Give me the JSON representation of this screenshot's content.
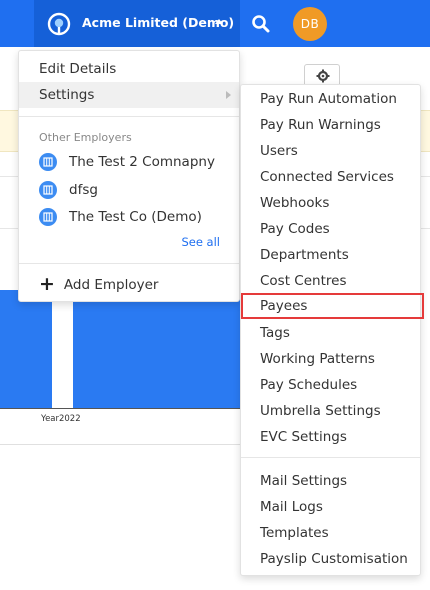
{
  "topbar": {
    "employer_name": "Acme Limited (Demo)",
    "avatar_initials": "DB"
  },
  "background": {
    "chart_x_label": "Year2022"
  },
  "employer_menu": {
    "edit_details": "Edit Details",
    "settings": "Settings",
    "other_employers_caption": "Other Employers",
    "other_employers": [
      "The Test 2 Comnapny",
      "dfsg",
      "The Test Co (Demo)"
    ],
    "see_all": "See all",
    "add_employer": "Add Employer"
  },
  "settings_menu": {
    "items": [
      "Pay Run Automation",
      "Pay Run Warnings",
      "Users",
      "Connected Services",
      "Webhooks",
      "Pay Codes",
      "Departments",
      "Cost Centres",
      "Payees",
      "Tags",
      "Working Patterns",
      "Pay Schedules",
      "Umbrella Settings",
      "EVC Settings"
    ],
    "secondary_items": [
      "Mail Settings",
      "Mail Logs",
      "Templates",
      "Payslip Customisation"
    ],
    "highlighted_item": "Payees"
  },
  "colors": {
    "topbar": "#1f6ff0",
    "accent": "#1f6ff0",
    "avatar": "#f09a26",
    "highlight_border": "#e53a3a"
  }
}
